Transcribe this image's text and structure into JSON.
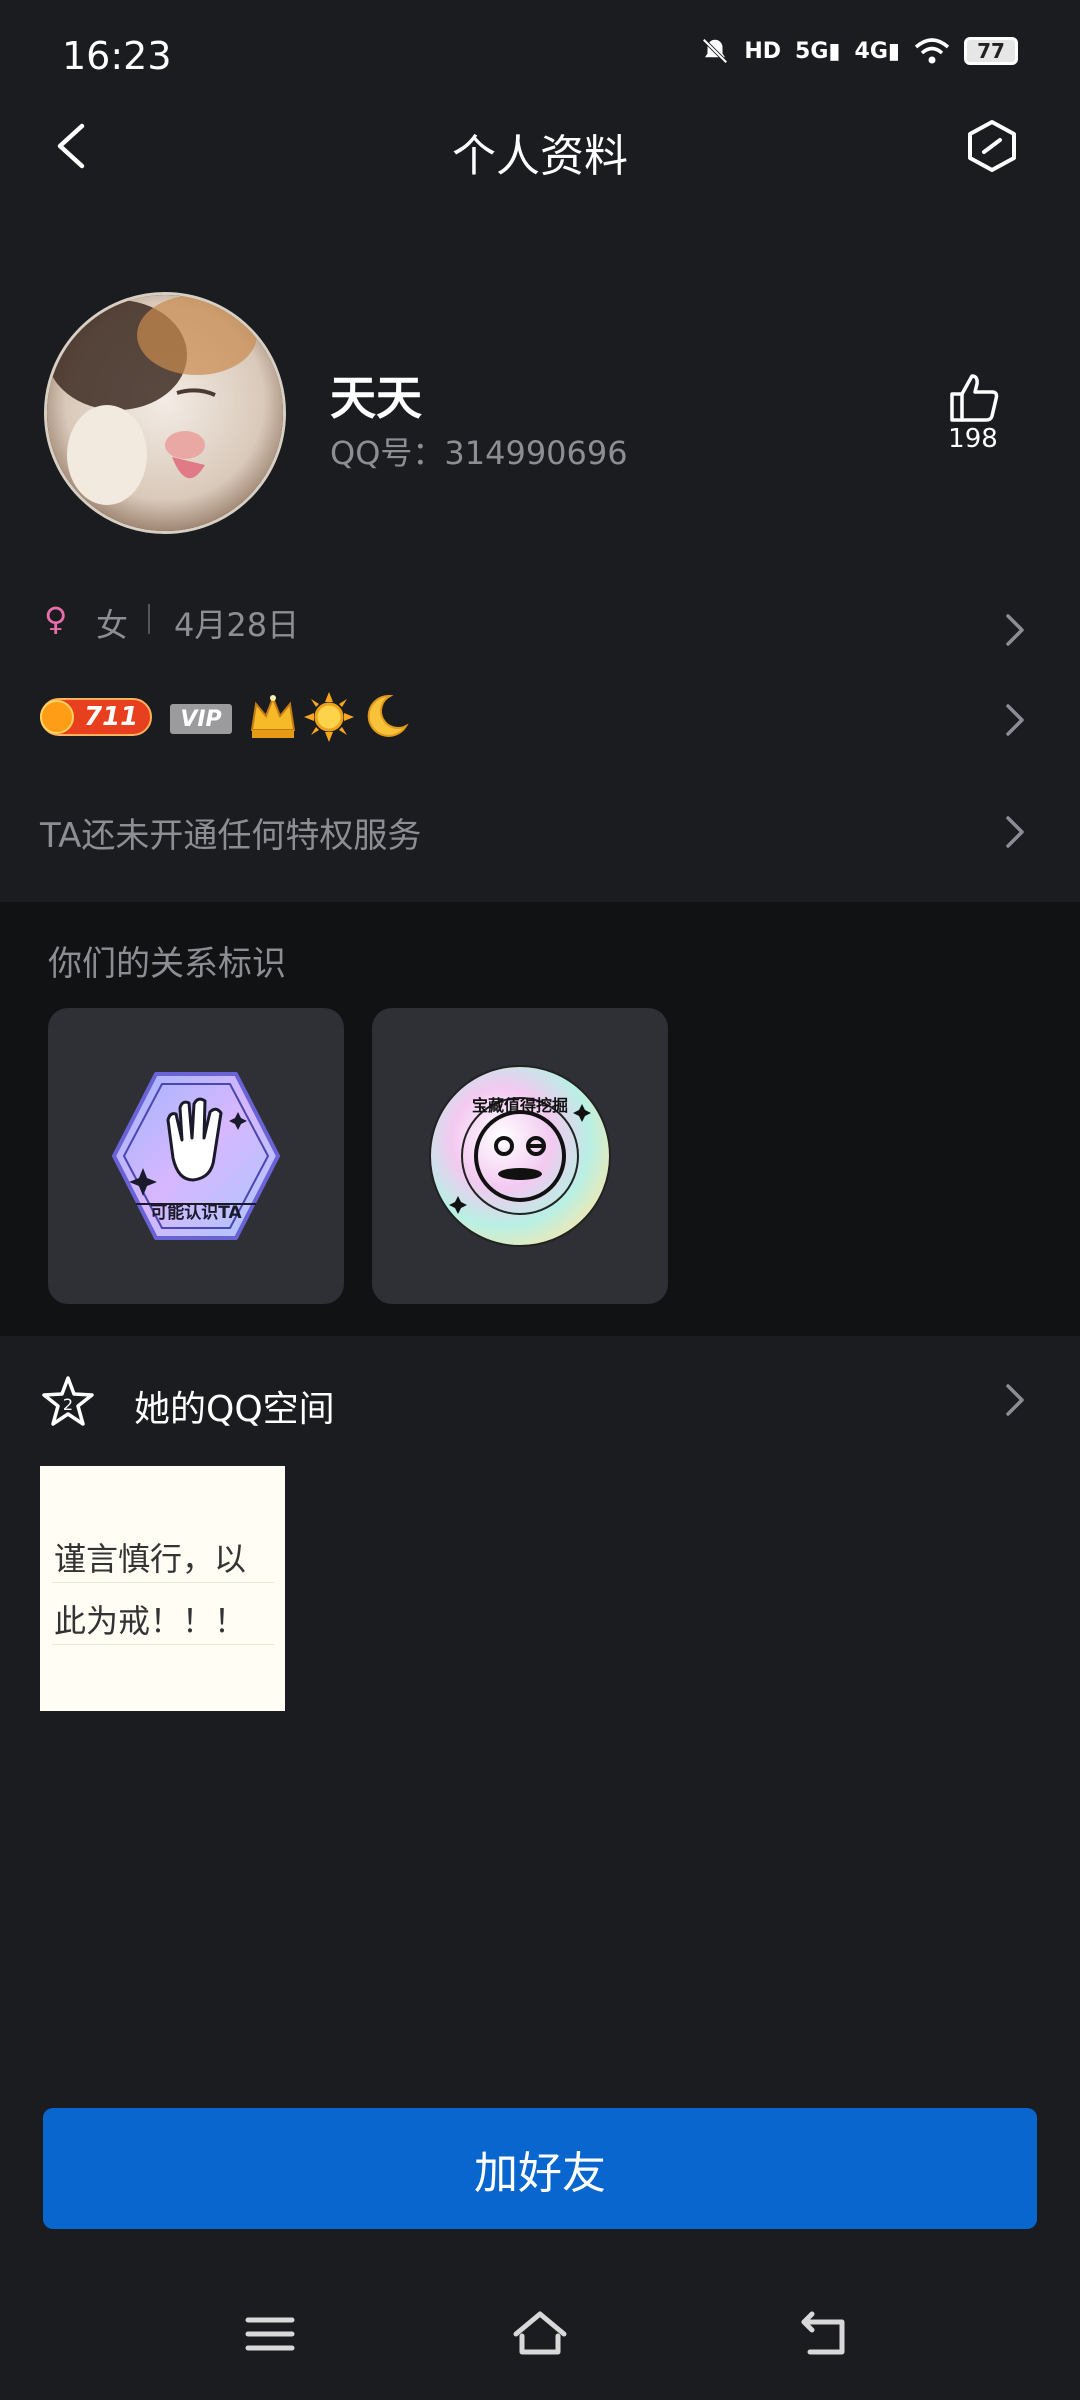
{
  "status_bar": {
    "time": "16:23",
    "indicators": [
      "bell-off-icon",
      "HD 1 2",
      "5G",
      "4G",
      "wifi-icon"
    ],
    "battery": "77"
  },
  "header": {
    "title": "个人资料",
    "back_icon": "back-arrow-icon",
    "settings_icon": "hexagon-settings-icon"
  },
  "profile": {
    "nickname": "天天",
    "qq_label": "QQ号：314990696",
    "likes": "198"
  },
  "info": {
    "gender": "女",
    "birthday": "4月28日",
    "level": "711",
    "vip": "VIP",
    "privilege_text": "TA还未开通任何特权服务"
  },
  "relationship": {
    "title": "你们的关系标识",
    "badges": [
      {
        "label": "可能认识TA",
        "icon": "wave-hand-badge-icon"
      },
      {
        "label": "宝藏值得挖掘",
        "icon": "treasure-face-badge-icon"
      }
    ]
  },
  "qzone": {
    "label": "她的QQ空间",
    "post_text": "谨言慎行，以此为戒！！！"
  },
  "actions": {
    "add_friend": "加好友"
  },
  "colors": {
    "background": "#1b1c20",
    "primary_button": "#0966cf",
    "secondary_text": "#8d8e93",
    "gender_pink": "#e86ea8"
  }
}
